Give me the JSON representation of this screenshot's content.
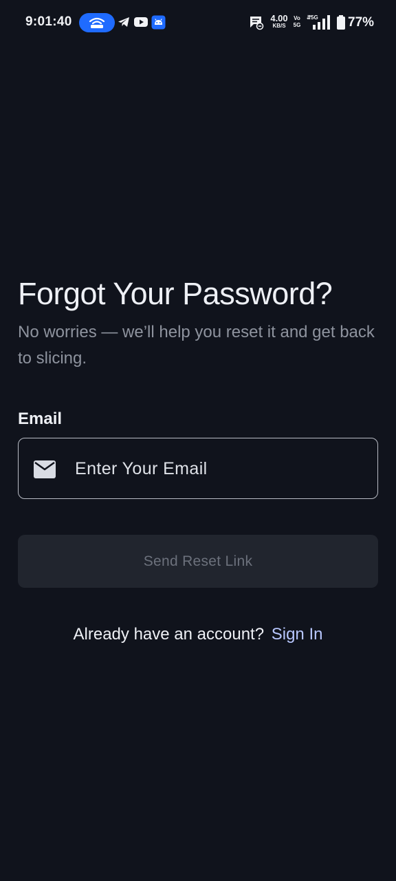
{
  "status_bar": {
    "time": "9:01:40",
    "net_speed_value": "4.00",
    "net_speed_unit": "KB/S",
    "volte_top": "Vo",
    "volte_bottom": "5G",
    "network_type": "5G",
    "battery_percent": "77%",
    "icons": [
      "hotspot-icon",
      "telegram-icon",
      "youtube-icon",
      "android-icon",
      "message-icon",
      "signal-icon",
      "battery-icon"
    ],
    "hotspot_color": "#1f6bff"
  },
  "forgot": {
    "title": "Forgot Your Password?",
    "subtitle": "No worries — we’ll help you reset it and get back to slicing.",
    "email_label": "Email",
    "email_placeholder": "Enter Your Email",
    "email_value": "",
    "send_button_label": "Send Reset Link",
    "signin_prompt": "Already have an account?",
    "signin_link": "Sign In"
  },
  "colors": {
    "background": "#10131c",
    "button_disabled_bg": "#21252e",
    "link": "#b8c7ff"
  }
}
